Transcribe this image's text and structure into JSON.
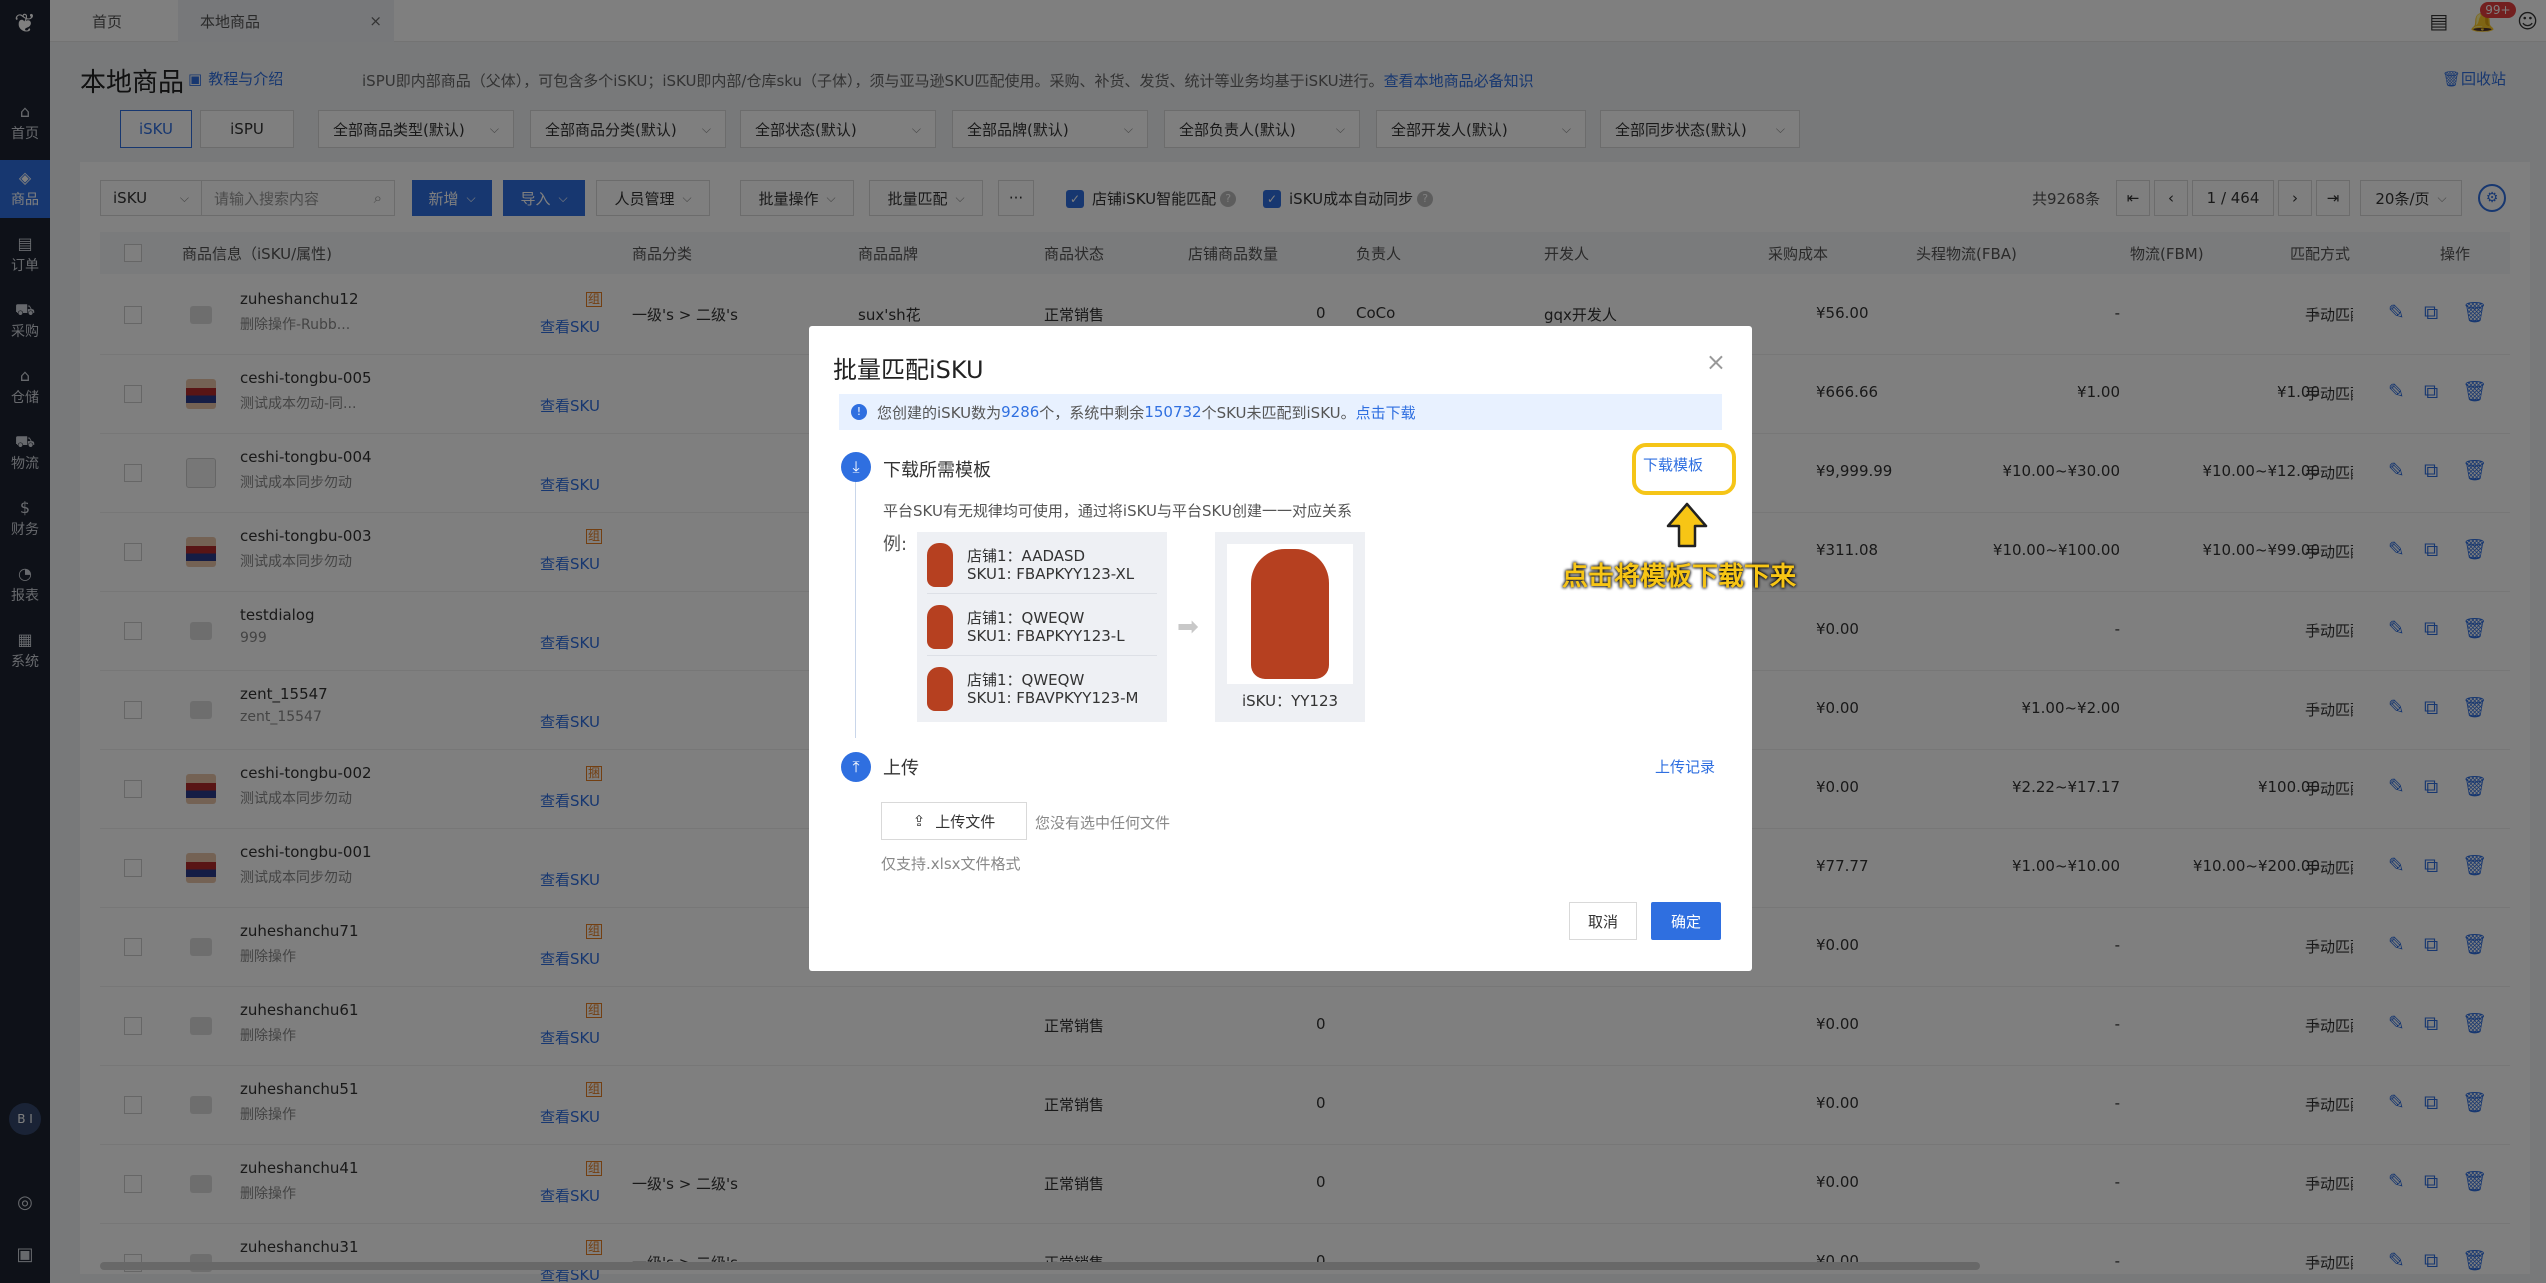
{
  "sidebar": {
    "items": [
      {
        "label": "首页",
        "icon": "home-icon",
        "glyph": "⌂"
      },
      {
        "label": "商品",
        "icon": "cube-icon",
        "glyph": "◈"
      },
      {
        "label": "订单",
        "icon": "order-icon",
        "glyph": "▤"
      },
      {
        "label": "采购",
        "icon": "cart-icon",
        "glyph": "⛟"
      },
      {
        "label": "仓储",
        "icon": "warehouse-icon",
        "glyph": "⌂"
      },
      {
        "label": "物流",
        "icon": "truck-icon",
        "glyph": "⛟"
      },
      {
        "label": "财务",
        "icon": "finance-icon",
        "glyph": "$"
      },
      {
        "label": "报表",
        "icon": "chart-icon",
        "glyph": "◔"
      },
      {
        "label": "系统",
        "icon": "system-icon",
        "glyph": "▦"
      }
    ],
    "avatar": "B I",
    "active_index": 1
  },
  "tabs": {
    "home": "首页",
    "local_goods": "本地商品",
    "close": "×"
  },
  "top_icons": {
    "badge": "99+"
  },
  "page": {
    "title": "本地商品",
    "help": "教程与介绍",
    "desc": "iSPU即内部商品（父体），可包含多个iSKU；iSKU即内部/仓库sku（子体），须与亚马逊SKU匹配使用。采购、补货、发货、统计等业务均基于iSKU进行。",
    "desc_link": "查看本地商品必备知识",
    "recycle": "回收站"
  },
  "filters": {
    "isku": "iSKU",
    "ispu": "iSPU",
    "dropdowns": [
      "全部商品类型(默认)",
      "全部商品分类(默认)",
      "全部状态(默认)",
      "全部品牌(默认)",
      "全部负责人(默认)",
      "全部开发人(默认)",
      "全部同步状态(默认)"
    ]
  },
  "toolbar": {
    "search_type": "iSKU",
    "search_placeholder": "请输入搜索内容",
    "add": "新增",
    "import": "导入",
    "staff": "人员管理",
    "batch_ops": "批量操作",
    "batch_match": "批量匹配",
    "more": "···",
    "smart_match": "店铺iSKU智能匹配",
    "auto_sync": "iSKU成本自动同步",
    "total": "共9268条",
    "page_current": "1",
    "page_total": "/ 464",
    "page_size": "20条/页"
  },
  "table": {
    "headers": [
      "商品信息（iSKU/属性)",
      "商品分类",
      "商品品牌",
      "商品状态",
      "店铺商品数量",
      "负责人",
      "开发人",
      "采购成本",
      "头程物流(FBA)",
      "物流(FBM)",
      "匹配方式",
      "操作"
    ],
    "view_sku": "查看SKU",
    "match": "手动匹配",
    "rows": [
      {
        "name": "zuheshanchu12",
        "sub": "删除操作-Rubb...",
        "tag": "组",
        "cat": "一级's > 二级's",
        "brand": "sux'sh花",
        "status": "正常销售",
        "qty": "0",
        "owner": "CoCo",
        "dev": "gqx开发人",
        "cost": "¥56.00",
        "fba": "-",
        "fbm": "-",
        "img": "placeholder"
      },
      {
        "name": "ceshi-tongbu-005",
        "sub": "测试成本勿动-同...",
        "tag": "",
        "cat": "",
        "brand": "",
        "status": "",
        "qty": "",
        "owner": "",
        "dev": "",
        "cost": "¥666.66",
        "fba": "¥1.00",
        "fbm": "¥1.00",
        "img": "model"
      },
      {
        "name": "ceshi-tongbu-004",
        "sub": "测试成本同步勿动",
        "tag": "",
        "cat": "",
        "brand": "",
        "status": "",
        "qty": "",
        "owner": "",
        "dev": "",
        "cost": "¥9,999.99",
        "fba": "¥10.00~¥30.00",
        "fbm": "¥10.00~¥12.00",
        "img": "box"
      },
      {
        "name": "ceshi-tongbu-003",
        "sub": "测试成本同步勿动",
        "tag": "组",
        "cat": "",
        "brand": "",
        "status": "",
        "qty": "",
        "owner": "",
        "dev": "",
        "cost": "¥311.08",
        "fba": "¥10.00~¥100.00",
        "fbm": "¥10.00~¥99.00",
        "img": "model"
      },
      {
        "name": "testdialog",
        "sub": "999",
        "tag": "",
        "cat": "",
        "brand": "",
        "status": "",
        "qty": "",
        "owner": "",
        "dev": "",
        "cost": "¥0.00",
        "fba": "-",
        "fbm": "-",
        "img": "placeholder"
      },
      {
        "name": "zent_15547",
        "sub": "zent_15547",
        "tag": "",
        "cat": "",
        "brand": "",
        "status": "",
        "qty": "",
        "owner": "",
        "dev": "",
        "cost": "¥0.00",
        "fba": "¥1.00~¥2.00",
        "fbm": "-",
        "img": "placeholder"
      },
      {
        "name": "ceshi-tongbu-002",
        "sub": "测试成本同步勿动",
        "tag": "捆",
        "cat": "",
        "brand": "",
        "status": "",
        "qty": "",
        "owner": "",
        "dev": "",
        "cost": "¥0.00",
        "fba": "¥2.22~¥17.17",
        "fbm": "¥100.00",
        "img": "model"
      },
      {
        "name": "ceshi-tongbu-001",
        "sub": "测试成本同步勿动",
        "tag": "",
        "cat": "",
        "brand": "",
        "status": "",
        "qty": "",
        "owner": "",
        "dev": "",
        "cost": "¥77.77",
        "fba": "¥1.00~¥10.00",
        "fbm": "¥10.00~¥200.00",
        "img": "model"
      },
      {
        "name": "zuheshanchu71",
        "sub": "删除操作",
        "tag": "组",
        "cat": "",
        "brand": "",
        "status": "",
        "qty": "",
        "owner": "",
        "dev": "",
        "cost": "¥0.00",
        "fba": "-",
        "fbm": "-",
        "img": "placeholder"
      },
      {
        "name": "zuheshanchu61",
        "sub": "删除操作",
        "tag": "组",
        "cat": "",
        "brand": "",
        "status": "正常销售",
        "qty": "0",
        "owner": "",
        "dev": "",
        "cost": "¥0.00",
        "fba": "-",
        "fbm": "-",
        "img": "placeholder"
      },
      {
        "name": "zuheshanchu51",
        "sub": "删除操作",
        "tag": "组",
        "cat": "",
        "brand": "",
        "status": "正常销售",
        "qty": "0",
        "owner": "",
        "dev": "",
        "cost": "¥0.00",
        "fba": "-",
        "fbm": "-",
        "img": "placeholder"
      },
      {
        "name": "zuheshanchu41",
        "sub": "删除操作",
        "tag": "组",
        "cat": "一级's > 二级's",
        "brand": "",
        "status": "正常销售",
        "qty": "0",
        "owner": "",
        "dev": "",
        "cost": "¥0.00",
        "fba": "-",
        "fbm": "-",
        "img": "placeholder"
      },
      {
        "name": "zuheshanchu31",
        "sub": "",
        "tag": "组",
        "cat": "一级's > 二级's",
        "brand": "",
        "status": "正常销售",
        "qty": "0",
        "owner": "",
        "dev": "",
        "cost": "¥0.00",
        "fba": "-",
        "fbm": "-",
        "img": "placeholder"
      }
    ]
  },
  "modal": {
    "title": "批量匹配iSKU",
    "alert_a": "您创建的iSKU数为",
    "alert_num1": "9286",
    "alert_b": "个，系统中剩余",
    "alert_num2": "150732",
    "alert_c": "个SKU未匹配到iSKU。",
    "alert_link": "点击下载",
    "step1_title": "下载所需模板",
    "download_template": "下载模板",
    "hint": "平台SKU有无规律均可使用，通过将iSKU与平台SKU创建一一对应关系",
    "example_label": "例:",
    "examples": [
      {
        "shop": "店铺1：AADASD",
        "sku": "SKU1: FBAPKYY123-XL"
      },
      {
        "shop": "店铺1：QWEQW",
        "sku": "SKU1: FBAPKYY123-L"
      },
      {
        "shop": "店铺1：QWEQW",
        "sku": "SKU1: FBAVPKYY123-M"
      }
    ],
    "isku": "iSKU：YY123",
    "step2_title": "上传",
    "upload_record": "上传记录",
    "upload_btn": "上传文件",
    "no_file": "您没有选中任何文件",
    "xlsx_only": "仅支持.xlsx文件格式",
    "cancel": "取消",
    "ok": "确定"
  },
  "annotation": "点击将模板下载下来",
  "colors": {
    "primary": "#2f6fe0",
    "highlight": "#f5c518",
    "sidebar": "#1c2230"
  }
}
